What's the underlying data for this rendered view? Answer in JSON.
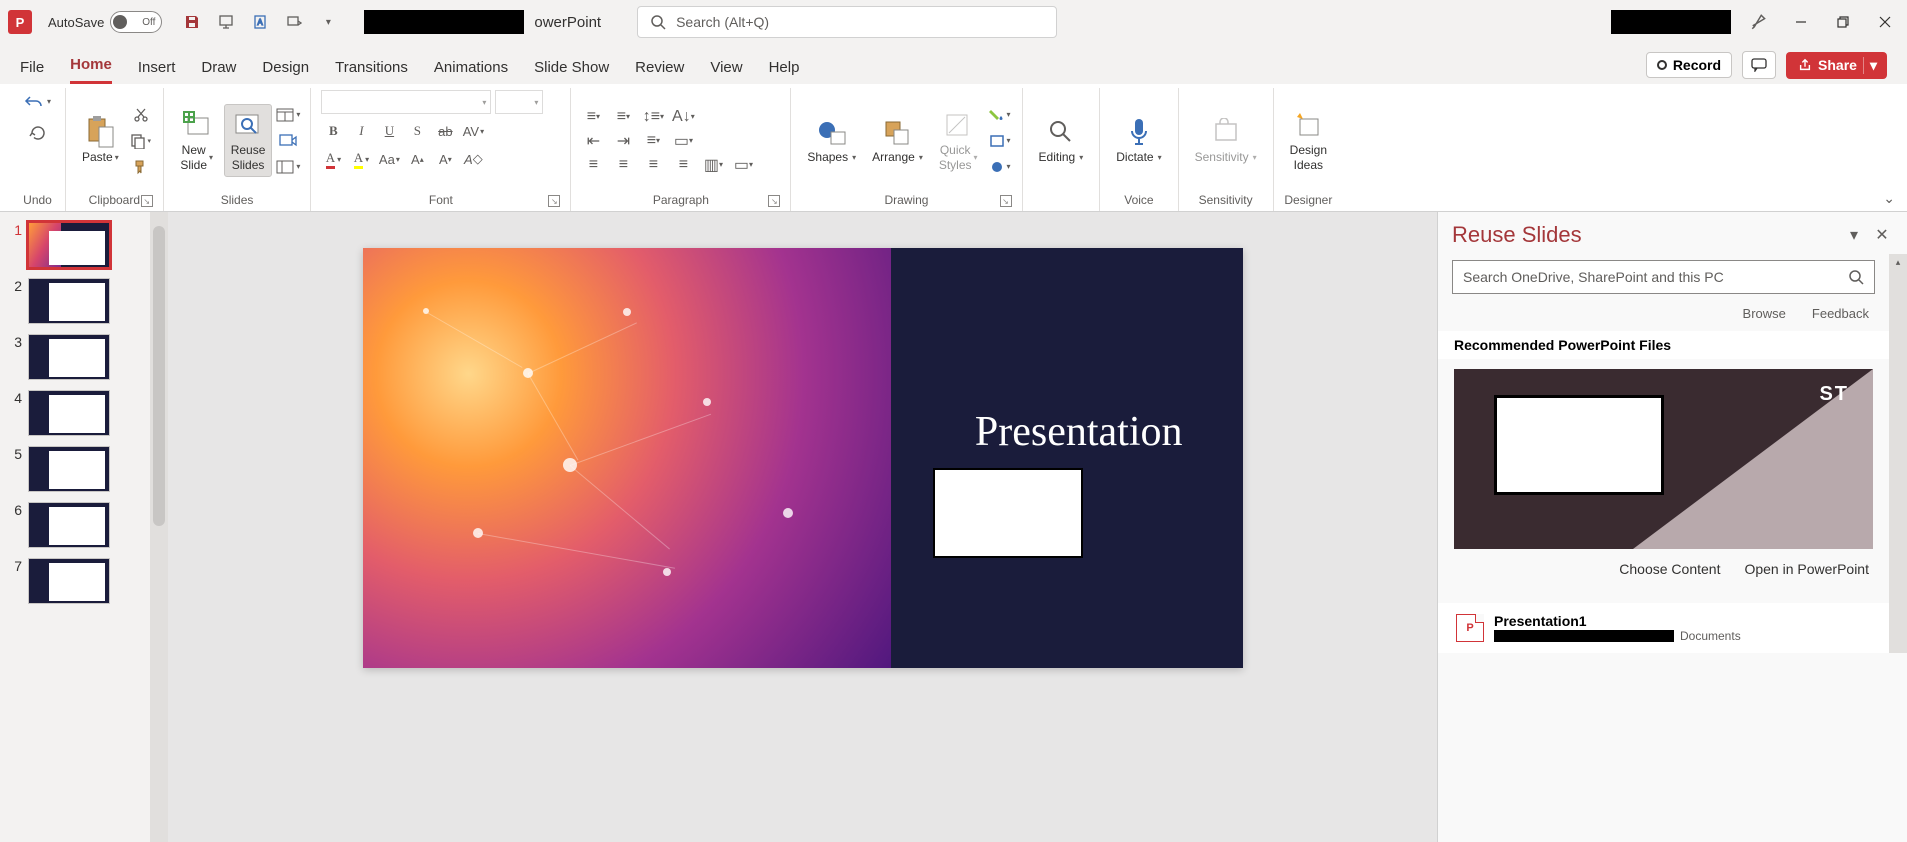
{
  "titleBar": {
    "autosave": "AutoSave",
    "autosaveState": "Off",
    "appName": "owerPoint",
    "searchPlaceholder": "Search (Alt+Q)"
  },
  "tabs": {
    "file": "File",
    "home": "Home",
    "insert": "Insert",
    "draw": "Draw",
    "design": "Design",
    "transitions": "Transitions",
    "animations": "Animations",
    "slideshow": "Slide Show",
    "review": "Review",
    "view": "View",
    "help": "Help",
    "record": "Record",
    "share": "Share"
  },
  "ribbon": {
    "undo": "Undo",
    "clipboard": "Clipboard",
    "paste": "Paste",
    "slides": "Slides",
    "newSlide": "New\nSlide",
    "reuseSlides": "Reuse\nSlides",
    "font": "Font",
    "paragraph": "Paragraph",
    "drawing": "Drawing",
    "shapes": "Shapes",
    "arrange": "Arrange",
    "quickStyles": "Quick\nStyles",
    "editing": "Editing",
    "voice": "Voice",
    "dictate": "Dictate",
    "sensitivity": "Sensitivity",
    "sensGroup": "Sensitivity",
    "designer": "Designer",
    "designIdeas": "Design\nIdeas"
  },
  "thumbs": [
    "1",
    "2",
    "3",
    "4",
    "5",
    "6",
    "7"
  ],
  "slide": {
    "title": "Presentation"
  },
  "reuse": {
    "title": "Reuse Slides",
    "searchPlaceholder": "Search OneDrive, SharePoint and this PC",
    "browse": "Browse",
    "feedback": "Feedback",
    "recommended": "Recommended PowerPoint Files",
    "cardText": "ST",
    "chooseContent": "Choose Content",
    "openIn": "Open in PowerPoint",
    "fileName": "Presentation1",
    "fileLoc": "Documents"
  }
}
